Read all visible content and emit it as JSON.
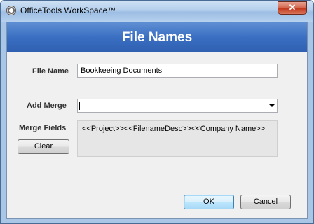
{
  "window": {
    "title": "OfficeTools WorkSpace™",
    "close_glyph": "✕"
  },
  "header": {
    "title": "File Names"
  },
  "form": {
    "file_name_label": "File Name",
    "file_name_value": "Bookkeeing Documents",
    "add_merge_label": "Add Merge",
    "add_merge_value": "",
    "merge_fields_label": "Merge Fields",
    "merge_fields_value": "<<Project>><<FilenameDesc>><<Company Name>>",
    "clear_label": "Clear"
  },
  "footer": {
    "ok_label": "OK",
    "cancel_label": "Cancel"
  },
  "colors": {
    "header_band": "#3a6fc2",
    "close_button": "#c2391c",
    "frame": "#a9c6e6"
  }
}
